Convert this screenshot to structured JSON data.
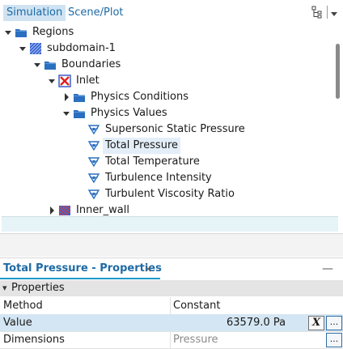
{
  "tabs": [
    {
      "label": "Simulation",
      "active": true
    },
    {
      "label": "Scene/Plot",
      "active": false
    }
  ],
  "toolbar": {
    "icons": [
      "tree-view-icon",
      "dropdown-arrow-icon"
    ]
  },
  "tree": [
    {
      "label": "Regions",
      "level": 0,
      "expander": "expanded",
      "icon": "folder-icon"
    },
    {
      "label": "subdomain-1",
      "level": 1,
      "expander": "expanded",
      "icon": "region-icon"
    },
    {
      "label": "Boundaries",
      "level": 2,
      "expander": "expanded",
      "icon": "folder-icon"
    },
    {
      "label": "Inlet",
      "level": 3,
      "expander": "expanded",
      "icon": "inlet-boundary-icon"
    },
    {
      "label": "Physics Conditions",
      "level": 4,
      "expander": "collapsed",
      "icon": "folder-icon"
    },
    {
      "label": "Physics Values",
      "level": 4,
      "expander": "expanded",
      "icon": "folder-icon"
    },
    {
      "label": "Supersonic Static Pressure",
      "level": 5,
      "expander": "none",
      "icon": "physics-value-icon"
    },
    {
      "label": "Total Pressure",
      "level": 5,
      "expander": "none",
      "icon": "physics-value-icon",
      "selected": true
    },
    {
      "label": "Total Temperature",
      "level": 5,
      "expander": "none",
      "icon": "physics-value-icon"
    },
    {
      "label": "Turbulence Intensity",
      "level": 5,
      "expander": "none",
      "icon": "physics-value-icon"
    },
    {
      "label": "Turbulent Viscosity Ratio",
      "level": 5,
      "expander": "none",
      "icon": "physics-value-icon"
    },
    {
      "label": "Inner_wall",
      "level": 3,
      "expander": "collapsed",
      "icon": "wall-boundary-icon"
    }
  ],
  "properties": {
    "tab_title": "Total Pressure - Properties",
    "close_glyph": "×",
    "minimize_glyph": "—",
    "section": "Properties",
    "section_glyph": "▾",
    "rows": [
      {
        "name": "Method",
        "value": "Constant",
        "muted": false,
        "highlight": false
      },
      {
        "name": "Value",
        "value": "63579.0 Pa",
        "muted": false,
        "highlight": true
      },
      {
        "name": "Dimensions",
        "value": "Pressure",
        "muted": true,
        "highlight": false
      }
    ],
    "x_button": "X",
    "ellipsis_button": "..."
  },
  "colors": {
    "accent": "#1d6aa5",
    "selection": "#d4e6f3",
    "folder": "#2a6fc0",
    "inlet_red": "#e02020"
  }
}
